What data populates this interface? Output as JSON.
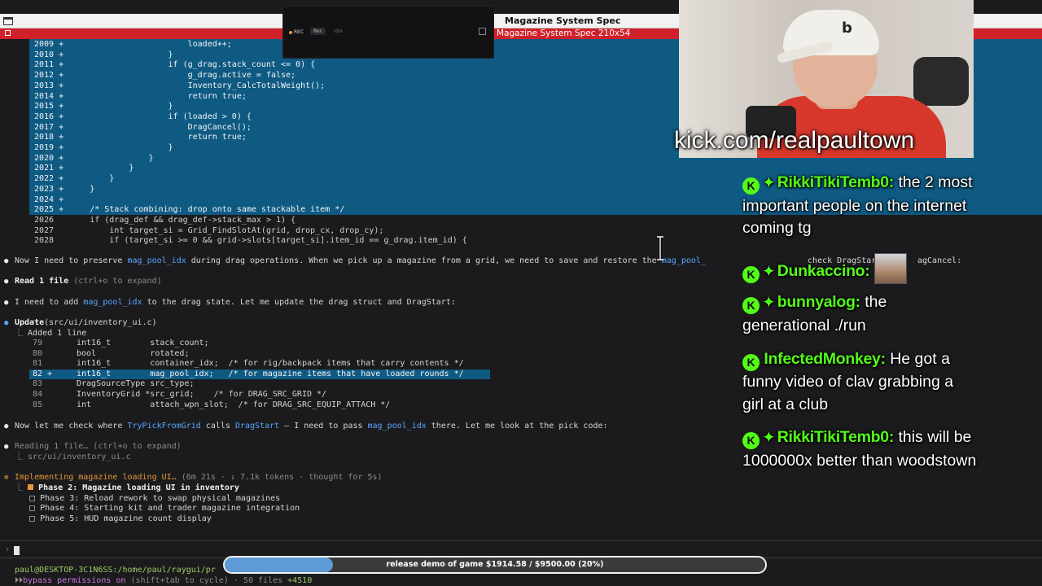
{
  "window": {
    "title": "Magazine System Spec"
  },
  "tmux": {
    "title": "Magazine System Spec 210x54"
  },
  "rec_panel": {
    "rec_label": "REC",
    "rec_button": "Rec",
    "idle_button": "Idle"
  },
  "code_lines": [
    {
      "n": "2009",
      "mark": "+",
      "text": "                        loaded++;",
      "added": true
    },
    {
      "n": "2010",
      "mark": "+",
      "text": "                    }",
      "added": true
    },
    {
      "n": "2011",
      "mark": "+",
      "text": "                    if (g_drag.stack_count <= 0) {",
      "added": true
    },
    {
      "n": "2012",
      "mark": "+",
      "text": "                        g_drag.active = false;",
      "added": true
    },
    {
      "n": "2013",
      "mark": "+",
      "text": "                        Inventory_CalcTotalWeight();",
      "added": true
    },
    {
      "n": "2014",
      "mark": "+",
      "text": "                        return true;",
      "added": true
    },
    {
      "n": "2015",
      "mark": "+",
      "text": "                    }",
      "added": true
    },
    {
      "n": "2016",
      "mark": "+",
      "text": "                    if (loaded > 0) {",
      "added": true
    },
    {
      "n": "2017",
      "mark": "+",
      "text": "                        DragCancel();",
      "added": true
    },
    {
      "n": "2018",
      "mark": "+",
      "text": "                        return true;",
      "added": true
    },
    {
      "n": "2019",
      "mark": "+",
      "text": "                    }",
      "added": true
    },
    {
      "n": "2020",
      "mark": "+",
      "text": "                }",
      "added": true
    },
    {
      "n": "2021",
      "mark": "+",
      "text": "            }",
      "added": true
    },
    {
      "n": "2022",
      "mark": "+",
      "text": "        }",
      "added": true
    },
    {
      "n": "2023",
      "mark": "+",
      "text": "    }",
      "added": true
    },
    {
      "n": "2024",
      "mark": "+",
      "text": "",
      "added": true
    },
    {
      "n": "2025",
      "mark": "+",
      "text": "    /* Stack combining: drop onto same stackable item */",
      "added": true
    },
    {
      "n": "2026",
      "mark": " ",
      "text": "    if (drag_def && drag_def->stack_max > 1) {",
      "added": false
    },
    {
      "n": "2027",
      "mark": " ",
      "text": "        int target_si = Grid_FindSlotAt(grid, drop_cx, drop_cy);",
      "added": false
    },
    {
      "n": "2028",
      "mark": " ",
      "text": "        if (target_si >= 0 && grid->slots[target_si].item_id == g_drag.item_id) {",
      "added": false
    }
  ],
  "messages": {
    "m1_a": "Now I need to preserve ",
    "m1_b": "mag_pool_idx",
    "m1_c": " during drag operations. When we pick up a magazine from a grid, we need to save and restore the ",
    "m1_d": "mag_pool_",
    "m1_e": "t",
    "m1_f": "check DragStart",
    "m1_g": "agCancel:",
    "read_label": "Read 1 file",
    "read_hint": " (ctrl+o to expand)",
    "m2_a": "I need to add ",
    "m2_b": "mag_pool_idx",
    "m2_c": " to the drag state. Let me update the drag struct and DragStart:",
    "update_label": "Update",
    "update_path": "(src/ui/inventory_ui.c)",
    "added_line": "Added 1 line",
    "m3_a": "Now let me check where ",
    "m3_b": "TryPickFromGrid",
    "m3_c": " calls ",
    "m3_d": "DragStart",
    "m3_e": " — I need to pass ",
    "m3_f": "mag_pool_idx",
    "m3_g": " there. Let me look at the pick code:",
    "reading_label": "Reading 1 file…",
    "reading_hint": " (ctrl+o to expand)",
    "reading_path": "src/ui/inventory_ui.c",
    "implementing_label": "Implementing magazine loading UI…",
    "implementing_meta": " (6m 21s · ↓ 7.1k tokens · thought for 5s)"
  },
  "diff_rows": [
    {
      "n": "79",
      "mark": " ",
      "text": "int16_t        stack_count;",
      "on": false
    },
    {
      "n": "80",
      "mark": " ",
      "text": "bool           rotated;",
      "on": false
    },
    {
      "n": "81",
      "mark": " ",
      "text": "int16_t        container_idx;  /* for rig/backpack items that carry contents */",
      "on": false
    },
    {
      "n": "82",
      "mark": "+",
      "text": "int16_t        mag_pool_idx;   /* for magazine items that have loaded rounds */",
      "on": true
    },
    {
      "n": "83",
      "mark": " ",
      "text": "DragSourceType src_type;",
      "on": false
    },
    {
      "n": "84",
      "mark": " ",
      "text": "InventoryGrid *src_grid;    /* for DRAG_SRC_GRID */",
      "on": false
    },
    {
      "n": "85",
      "mark": " ",
      "text": "int            attach_wpn_slot;  /* for DRAG_SRC_EQUIP_ATTACH */",
      "on": false
    }
  ],
  "tasks": [
    {
      "label": "Phase 2: Magazine loading UI in inventory",
      "active": true
    },
    {
      "label": "Phase 3: Reload rework to swap physical magazines",
      "active": false
    },
    {
      "label": "Phase 4: Starting kit and trader magazine integration",
      "active": false
    },
    {
      "label": "Phase 5: HUD magazine count display",
      "active": false
    }
  ],
  "prompt": {
    "caret": "›"
  },
  "status": {
    "path": "paul@DESKTOP-3C1N6SS:/home/paul/raygui/pr",
    "perm_a": "bypass permissions on",
    "perm_b": " (shift+tab to cycle) · 50 files ",
    "perm_c": "+4510"
  },
  "stream": {
    "url": "kick.com/realpaultown",
    "cap_logo": "b"
  },
  "chat": [
    {
      "user": "RikkiTikiTemb0:",
      "text": "the 2 most important people on the internet coming tg",
      "avatar": false
    },
    {
      "user": "Dunkaccino:",
      "text": "",
      "avatar": true
    },
    {
      "user": "bunnyalog:",
      "text": "the generational ./run",
      "avatar": false
    },
    {
      "user": "InfectedMonkey:",
      "text": "He got a funny video of clav grabbing a girl at a club",
      "avatar": false,
      "no_sub": true
    },
    {
      "user": "RikkiTikiTemb0:",
      "text": "this will be 1000000x better than woodstown",
      "avatar": false
    }
  ],
  "goal": {
    "text": "release demo of game $1914.58 / $9500.00 (20%)",
    "progress": 0.2
  },
  "colors": {
    "accent_blue": "#0e5a83",
    "kick_green": "#53fc18",
    "tmux_red": "#d0202a"
  }
}
